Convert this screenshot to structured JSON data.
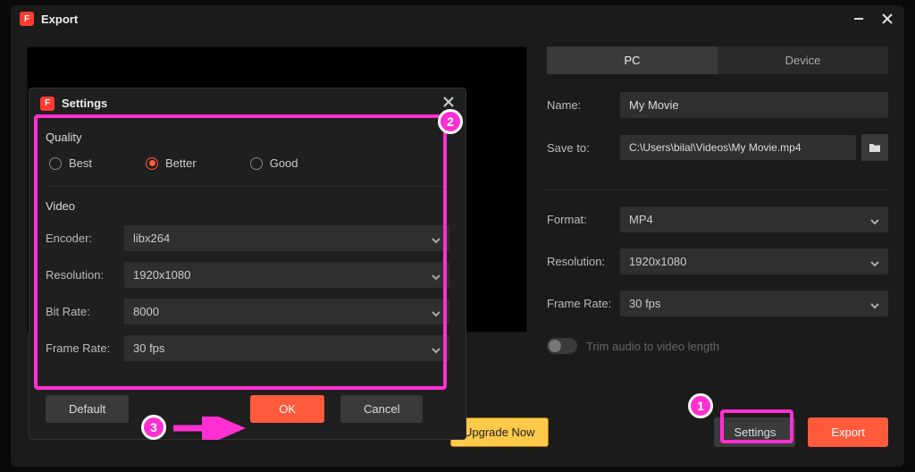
{
  "window": {
    "title": "Export",
    "minimize": "–",
    "close": "×"
  },
  "tabs": {
    "pc": "PC",
    "device": "Device"
  },
  "fields": {
    "name_label": "Name:",
    "name_value": "My Movie",
    "saveto_label": "Save to:",
    "saveto_value": "C:\\Users\\bilal\\Videos\\My Movie.mp4",
    "format_label": "Format:",
    "format_value": "MP4",
    "resolution_label": "Resolution:",
    "resolution_value": "1920x1080",
    "framerate_label": "Frame Rate:",
    "framerate_value": "30 fps",
    "trim_label": "Trim audio to video length"
  },
  "buttons": {
    "upgrade": "Upgrade Now",
    "settings": "Settings",
    "export": "Export"
  },
  "settings_dialog": {
    "title": "Settings",
    "quality_title": "Quality",
    "quality": {
      "best": "Best",
      "better": "Better",
      "good": "Good"
    },
    "video_title": "Video",
    "encoder_label": "Encoder:",
    "encoder_value": "libx264",
    "resolution_label": "Resolution:",
    "resolution_value": "1920x1080",
    "bitrate_label": "Bit Rate:",
    "bitrate_value": "8000",
    "framerate_label": "Frame Rate:",
    "framerate_value": "30 fps",
    "default_btn": "Default",
    "ok_btn": "OK",
    "cancel_btn": "Cancel"
  },
  "annotations": {
    "n1": "1",
    "n2": "2",
    "n3": "3"
  }
}
